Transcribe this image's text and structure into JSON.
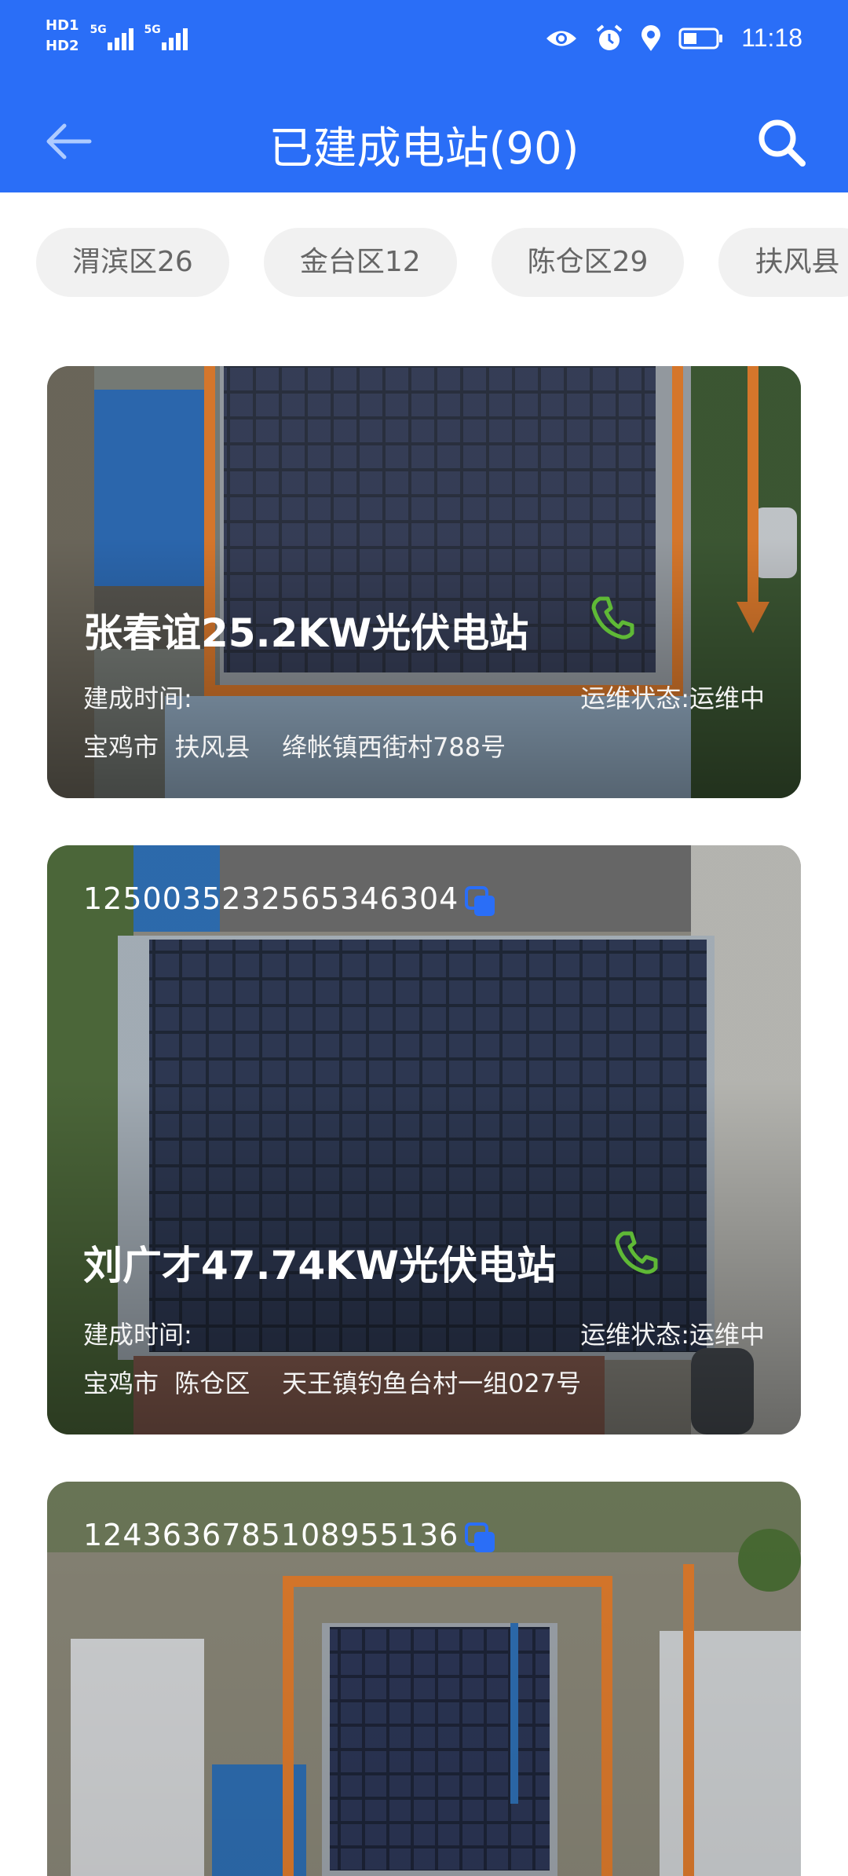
{
  "status_bar": {
    "hd1": "HD1",
    "hd2": "HD2",
    "net1": "5G",
    "net2": "5G",
    "time": "11:18"
  },
  "header": {
    "title": "已建成电站(90)"
  },
  "chips": [
    {
      "label": "渭滨区26"
    },
    {
      "label": "金台区12"
    },
    {
      "label": "陈仓区29"
    },
    {
      "label": "扶风县"
    }
  ],
  "stations": [
    {
      "id": "",
      "title": "张春谊25.2KW光伏电站",
      "built_label": "建成时间:",
      "status_label": "运维状态:",
      "status_value": "运维中",
      "city": "宝鸡市",
      "county": "扶风县",
      "address": "绛帐镇西街村788号"
    },
    {
      "id": "1250035232565346304",
      "title": "刘广才47.74KW光伏电站",
      "built_label": "建成时间:",
      "status_label": "运维状态:",
      "status_value": "运维中",
      "city": "宝鸡市",
      "county": "陈仓区",
      "address": "天王镇钓鱼台村一组027号"
    },
    {
      "id": "1243636785108955136",
      "title": "",
      "built_label": "",
      "status_label": "",
      "status_value": "",
      "city": "",
      "county": "",
      "address": ""
    }
  ],
  "colors": {
    "header_bg": "#2a6ef7",
    "phone_icon": "#5fb936",
    "copy_icon": "#2a6ef7",
    "chip_bg": "#f1f1f1",
    "chip_text": "#666666"
  }
}
